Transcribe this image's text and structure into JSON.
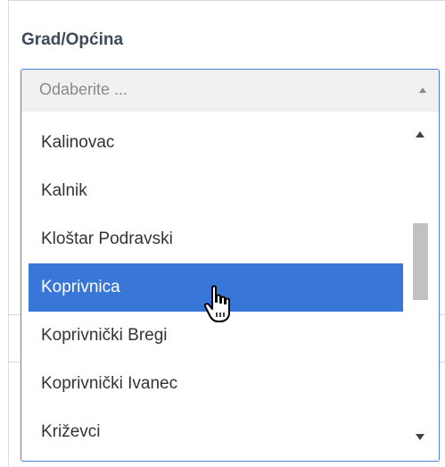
{
  "field": {
    "label": "Grad/Općina",
    "placeholder": "Odaberite ..."
  },
  "dropdown": {
    "options": [
      "Kalinovac",
      "Kalnik",
      "Kloštar Podravski",
      "Koprivnica",
      "Koprivnički Bregi",
      "Koprivnički Ivanec",
      "Križevci"
    ],
    "highlighted": "Koprivnica"
  },
  "colors": {
    "highlight": "#3876d8",
    "focus_border": "#4a7fe0",
    "label_text": "#3c4a5a"
  },
  "icons": {
    "select_arrow": "caret-up-icon",
    "scroll_up": "scroll-up-arrow-icon",
    "scroll_down": "scroll-down-arrow-icon",
    "cursor": "hand-pointer-cursor-icon"
  }
}
